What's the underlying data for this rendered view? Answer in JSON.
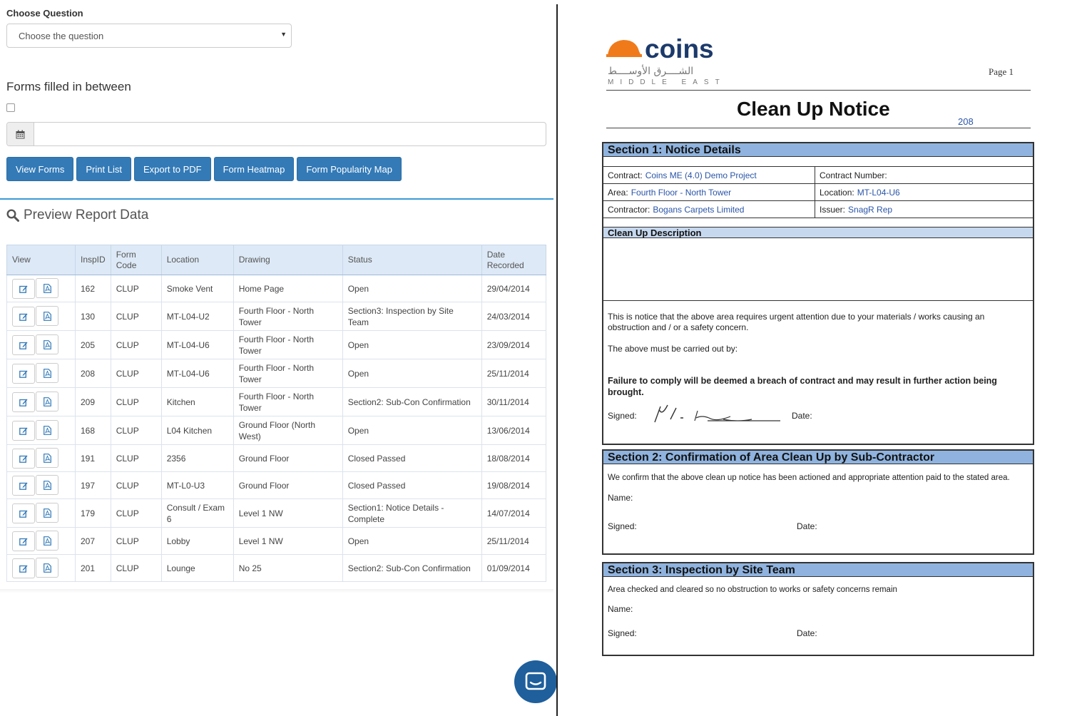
{
  "filters": {
    "choose_question_label": "Choose Question",
    "question_placeholder": "Choose the question",
    "forms_between_label": "Forms filled in between",
    "date_value": ""
  },
  "actions": {
    "view_forms": "View Forms",
    "print_list": "Print List",
    "export_pdf": "Export to PDF",
    "form_heatmap": "Form Heatmap",
    "form_popularity_map": "Form Popularity Map"
  },
  "preview": {
    "title": "Preview Report Data"
  },
  "table": {
    "headers": {
      "view": "View",
      "insp_id": "InspID",
      "form_code": "Form Code",
      "location": "Location",
      "drawing": "Drawing",
      "status": "Status",
      "date_recorded": "Date Recorded"
    },
    "rows": [
      {
        "insp_id": "162",
        "form_code": "CLUP",
        "location": "Smoke Vent",
        "drawing": "Home Page",
        "status": "Open",
        "date": "29/04/2014"
      },
      {
        "insp_id": "130",
        "form_code": "CLUP",
        "location": "MT-L04-U2",
        "drawing": "Fourth Floor - North Tower",
        "status": "Section3: Inspection by Site Team",
        "date": "24/03/2014"
      },
      {
        "insp_id": "205",
        "form_code": "CLUP",
        "location": "MT-L04-U6",
        "drawing": "Fourth Floor - North Tower",
        "status": "Open",
        "date": "23/09/2014"
      },
      {
        "insp_id": "208",
        "form_code": "CLUP",
        "location": "MT-L04-U6",
        "drawing": "Fourth Floor - North Tower",
        "status": "Open",
        "date": "25/11/2014"
      },
      {
        "insp_id": "209",
        "form_code": "CLUP",
        "location": "Kitchen",
        "drawing": "Fourth Floor - North Tower",
        "status": "Section2: Sub-Con Confirmation",
        "date": "30/11/2014"
      },
      {
        "insp_id": "168",
        "form_code": "CLUP",
        "location": "L04 Kitchen",
        "drawing": "Ground Floor (North West)",
        "status": "Open",
        "date": "13/06/2014"
      },
      {
        "insp_id": "191",
        "form_code": "CLUP",
        "location": "2356",
        "drawing": "Ground Floor",
        "status": "Closed Passed",
        "date": "18/08/2014"
      },
      {
        "insp_id": "197",
        "form_code": "CLUP",
        "location": "MT-L0-U3",
        "drawing": "Ground Floor",
        "status": "Closed Passed",
        "date": "19/08/2014"
      },
      {
        "insp_id": "179",
        "form_code": "CLUP",
        "location": "Consult / Exam 6",
        "drawing": "Level 1 NW",
        "status": "Section1: Notice Details - Complete",
        "date": "14/07/2014"
      },
      {
        "insp_id": "207",
        "form_code": "CLUP",
        "location": "Lobby",
        "drawing": "Level 1 NW",
        "status": "Open",
        "date": "25/11/2014"
      },
      {
        "insp_id": "201",
        "form_code": "CLUP",
        "location": "Lounge",
        "drawing": "No 25",
        "status": "Section2: Sub-Con Confirmation",
        "date": "01/09/2014"
      }
    ]
  },
  "document": {
    "logo_word": "coins",
    "logo_arabic": "الشــــرق الأوســــط",
    "logo_sub": "MIDDLE EAST",
    "page": "Page 1",
    "title": "Clean Up Notice",
    "number": "208",
    "section1": {
      "heading": "Section 1: Notice Details",
      "contract_label": "Contract:",
      "contract_value": "Coins ME (4.0) Demo Project",
      "contract_number_label": "Contract Number:",
      "area_label": "Area:",
      "area_value": "Fourth Floor - North Tower",
      "location_label": "Location:",
      "location_value": "MT-L04-U6",
      "contractor_label": "Contractor:",
      "contractor_value": "Bogans Carpets Limited",
      "issuer_label": "Issuer:",
      "issuer_value": "SnagR Rep",
      "desc_heading": "Clean Up Description",
      "notice_text": "This is notice that the above area requires urgent attention due to your materials / works causing an obstruction and / or a safety concern.",
      "carried_out": "The above must be carried out by:",
      "failure_text": "Failure to comply will be deemed a breach of contract and may result in further action being brought.",
      "signed_label": "Signed:",
      "date_label": "Date:"
    },
    "section2": {
      "heading": "Section 2: Confirmation of Area Clean Up by Sub-Contractor",
      "text": "We confirm that the above clean up notice has been actioned and appropriate attention paid to the stated area.",
      "name_label": "Name:",
      "signed_label": "Signed:",
      "date_label": "Date:"
    },
    "section3": {
      "heading": "Section 3: Inspection by Site Team",
      "text": "Area checked and cleared so no obstruction to works or safety concerns remain",
      "name_label": "Name:",
      "signed_label": "Signed:",
      "date_label": "Date:"
    }
  },
  "colors": {
    "primary_button": "#337ab7",
    "accent_line": "#3c9bd3",
    "table_header": "#dde9f6",
    "section_header": "#8fb3de",
    "logo_orange": "#f07a1a",
    "logo_navy": "#1c3a6b",
    "chat_bubble": "#1e5f9c"
  },
  "icons": {
    "calendar": "calendar-icon",
    "search": "search-icon",
    "edit": "edit-icon",
    "pdf": "pdf-icon",
    "chat": "chat-icon"
  }
}
